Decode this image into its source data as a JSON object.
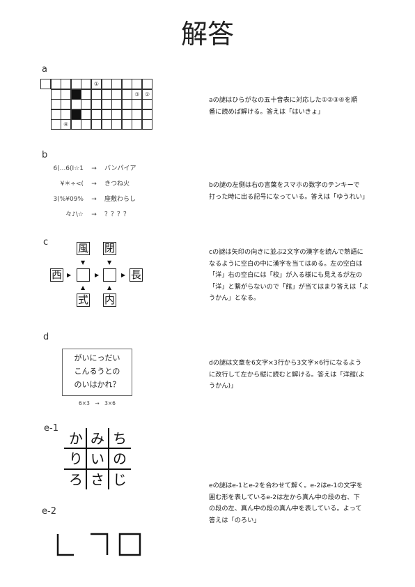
{
  "title": "解答",
  "sections": {
    "a": {
      "label": "a",
      "marks": [
        "①",
        "③",
        "②",
        "④"
      ],
      "explanation": [
        "aの謎はひらがなの五十音表に対応した①②③④を順",
        "番に読めば解ける。答えは「はいきょ」"
      ]
    },
    "b": {
      "label": "b",
      "rows": [
        {
          "src": "6(...6(I☆1",
          "arrow": "→",
          "dst": "バンパイア"
        },
        {
          "src": "¥＊÷<(",
          "arrow": "→",
          "dst": "きつね火"
        },
        {
          "src": "3(%¥09%",
          "arrow": "→",
          "dst": "座敷わらし"
        },
        {
          "src": "々♪\\☆",
          "arrow": "→",
          "dst": "？？？？"
        }
      ],
      "explanation": [
        "bの謎の左側は右の言葉をスマホの数字のテンキーで",
        "打った時に出る記号になっている。答えは「ゆうれい」"
      ]
    },
    "c": {
      "label": "c",
      "kanji": {
        "top_left": "風",
        "top_right": "閉",
        "left": "西",
        "right": "長",
        "bottom_left": "式",
        "bottom_right": "内"
      },
      "explanation": [
        "cの謎は矢印の向きに並ぶ2文字の漢字を読んで熟語に",
        "なるように空白の中に漢字を当てはめる。左の空白は",
        "「洋」右の空白には「校」が入る様にも見えるが左の",
        "「洋」と繋がらないので「館」が当てはまり答えは「よ",
        "うかん」となる。"
      ]
    },
    "d": {
      "label": "d",
      "box_lines": [
        "がいにっだい",
        "こんるうとの",
        "のいはかれ？"
      ],
      "caption": "6×3　→　3×6",
      "explanation": [
        "dの謎は文章を6文字×3行から3文字×6行になるよう",
        "に改行して左から縦に読むと解ける。答えは「洋館(よ",
        "うかん)」"
      ]
    },
    "e": {
      "label1": "e-1",
      "grid": [
        [
          "か",
          "み",
          "ち"
        ],
        [
          "り",
          "い",
          "の"
        ],
        [
          "ろ",
          "さ",
          "じ"
        ]
      ],
      "label2": "e-2",
      "explanation": [
        "eの謎はe-1とe-2を合わせて解く。e-2はe-1の文字を",
        "囲む形を表しているe-2は左から真ん中の段の右、下",
        "の段の左、真ん中の段の真ん中を表している。よって",
        "答えは「のろい」"
      ]
    }
  }
}
